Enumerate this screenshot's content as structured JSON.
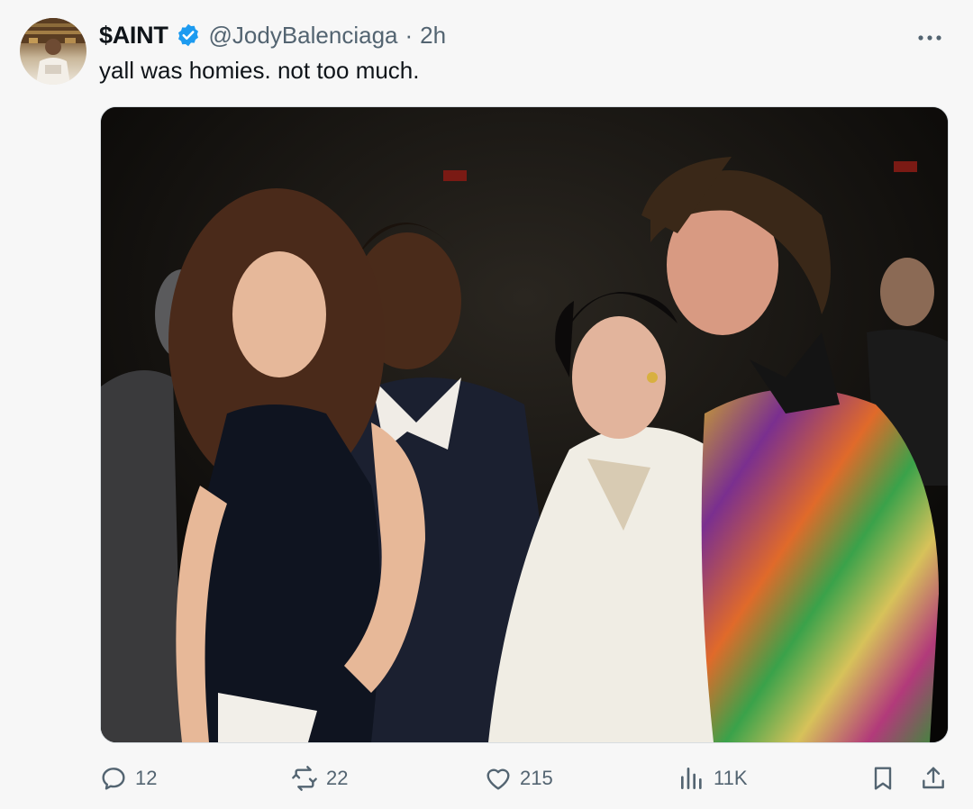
{
  "tweet": {
    "author": {
      "display_name": "$AINT",
      "handle": "@JodyBalenciaga",
      "verified": true
    },
    "separator": "·",
    "time_ago": "2h",
    "more_icon": "more-horizontal-icon",
    "text": "yall was homies. not too much.",
    "media": {
      "type": "photo"
    },
    "actions": {
      "reply": {
        "icon": "reply-icon",
        "count": "12"
      },
      "retweet": {
        "icon": "retweet-icon",
        "count": "22"
      },
      "like": {
        "icon": "heart-icon",
        "count": "215"
      },
      "views": {
        "icon": "views-icon",
        "count": "11K"
      },
      "bookmark": {
        "icon": "bookmark-icon"
      },
      "share": {
        "icon": "share-icon"
      }
    }
  },
  "colors": {
    "background": "#f7f7f7",
    "text": "#0f1419",
    "secondary_text": "#536471",
    "verified_badge": "#1d9bf0"
  }
}
